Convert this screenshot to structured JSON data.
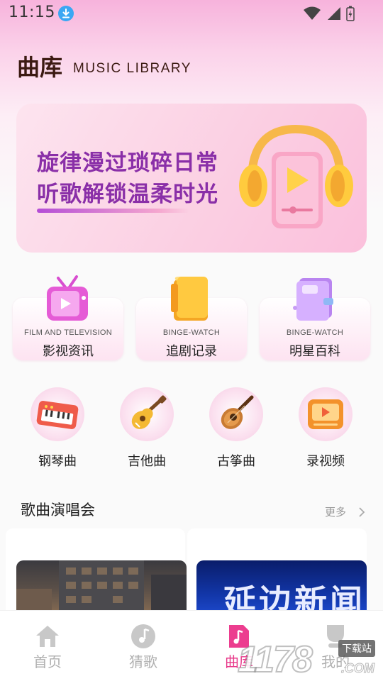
{
  "status_bar": {
    "time": "11:15",
    "icons": [
      "download-badge",
      "wifi-icon",
      "signal-icon",
      "battery-charging-icon"
    ]
  },
  "header": {
    "title": "曲库",
    "subtitle": "MUSIC LIBRARY"
  },
  "banner": {
    "line1": "旋律漫过琐碎日常",
    "line2": "听歌解锁温柔时光",
    "art_icon": "headphones-player-icon"
  },
  "categories": [
    {
      "en": "FILM AND TELEVISION",
      "cn": "影视资讯",
      "icon": "tv-icon"
    },
    {
      "en": "BINGE-WATCH",
      "cn": "追剧记录",
      "icon": "folder-icon"
    },
    {
      "en": "BINGE-WATCH",
      "cn": "明星百科",
      "icon": "notebook-icon"
    }
  ],
  "instruments": [
    {
      "label": "钢琴曲",
      "icon": "piano-icon"
    },
    {
      "label": "吉他曲",
      "icon": "guitar-icon"
    },
    {
      "label": "古筝曲",
      "icon": "lute-icon"
    },
    {
      "label": "录视频",
      "icon": "video-player-icon"
    }
  ],
  "section": {
    "title": "歌曲演唱会",
    "more": "更多"
  },
  "concerts": [
    {
      "image_icon": "building-photo"
    },
    {
      "image_text": "延边新闻"
    }
  ],
  "bottom_nav": [
    {
      "label": "首页",
      "icon": "home-icon",
      "active": false
    },
    {
      "label": "猜歌",
      "icon": "music-note-icon",
      "active": false
    },
    {
      "label": "曲库",
      "icon": "music-file-icon",
      "active": true
    },
    {
      "label": "我的",
      "icon": "user-icon",
      "active": false
    }
  ],
  "watermark": {
    "text": "1178",
    "badge": "下载站",
    "domain": ".COM"
  },
  "colors": {
    "accent": "#e8388a",
    "banner_text": "#8a2fa8",
    "title": "#3b1a12"
  }
}
